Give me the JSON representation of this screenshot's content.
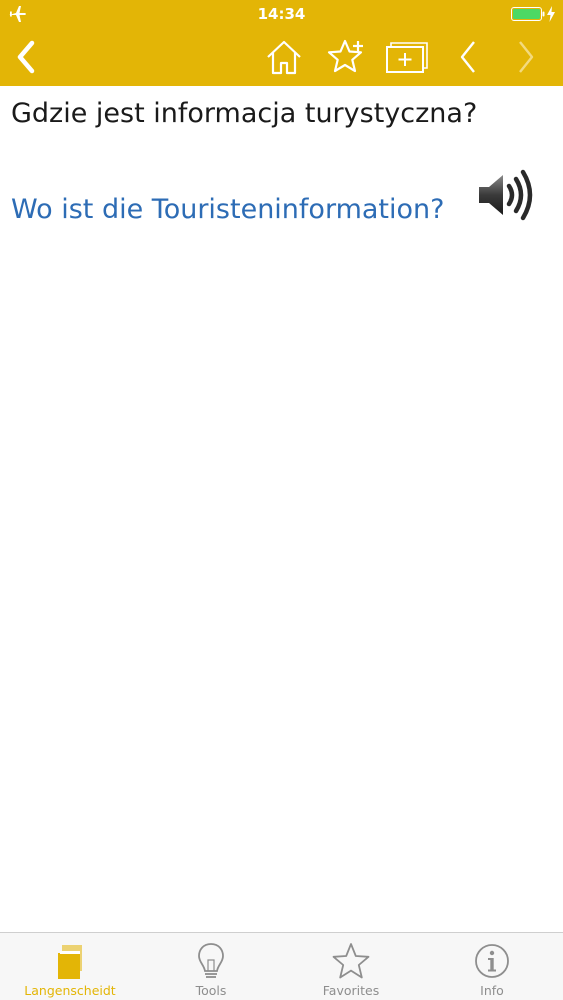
{
  "status": {
    "time": "14:34",
    "airplane_icon": "airplane-icon",
    "battery_icon": "battery-icon",
    "battery_color": "#4cd964"
  },
  "nav": {
    "icons": [
      "chevron-left-icon",
      "home-icon",
      "star-plus-icon",
      "card-plus-icon",
      "chevron-left-icon",
      "chevron-right-icon"
    ],
    "accent": "#e3b506"
  },
  "phrase": {
    "source": "Gdzie jest informacja turystyczna?",
    "target": "Wo ist die Touristeninformation?",
    "source_color": "#1a1a1a",
    "target_color": "#2d6cb5",
    "audio_icon": "speaker-icon"
  },
  "tabs": [
    {
      "label": "Langenscheidt",
      "icon": "book-icon",
      "active": true
    },
    {
      "label": "Tools",
      "icon": "lightbulb-icon",
      "active": false
    },
    {
      "label": "Favorites",
      "icon": "star-icon",
      "active": false
    },
    {
      "label": "Info",
      "icon": "info-icon",
      "active": false
    }
  ]
}
